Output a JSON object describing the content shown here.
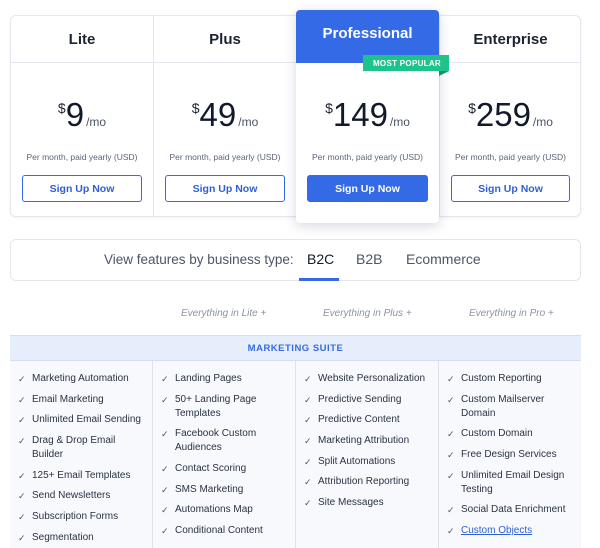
{
  "plans": [
    {
      "name": "Lite",
      "currency": "$",
      "amount": "9",
      "period": "/mo",
      "note": "Per month, paid yearly (USD)",
      "cta": "Sign Up Now"
    },
    {
      "name": "Plus",
      "currency": "$",
      "amount": "49",
      "period": "/mo",
      "note": "Per month, paid yearly (USD)",
      "cta": "Sign Up Now"
    },
    {
      "name": "Professional",
      "currency": "$",
      "amount": "149",
      "period": "/mo",
      "note": "Per month, paid yearly (USD)",
      "cta": "Sign Up Now",
      "badge": "MOST POPULAR"
    },
    {
      "name": "Enterprise",
      "currency": "$",
      "amount": "259",
      "period": "/mo",
      "note": "Per month, paid yearly (USD)",
      "cta": "Sign Up Now"
    }
  ],
  "selector": {
    "label": "View features by business type:",
    "options": [
      "B2C",
      "B2B",
      "Ecommerce"
    ],
    "selected": "B2C"
  },
  "everything": [
    "Everything in Lite +",
    "Everything in Plus +",
    "Everything in Pro +"
  ],
  "suite_title": "MARKETING SUITE",
  "features": [
    [
      "Marketing Automation",
      "Email Marketing",
      "Unlimited Email Sending",
      "Drag & Drop Email Builder",
      "125+ Email Templates",
      "Send Newsletters",
      "Subscription Forms",
      "Segmentation"
    ],
    [
      "Landing Pages",
      "50+ Landing Page Templates",
      "Facebook Custom Audiences",
      "Contact Scoring",
      "SMS Marketing",
      "Automations Map",
      "Conditional Content"
    ],
    [
      "Website Personalization",
      "Predictive Sending",
      "Predictive Content",
      "Marketing Attribution",
      "Split Automations",
      "Attribution Reporting",
      "Site Messages"
    ],
    [
      "Custom Reporting",
      "Custom Mailserver Domain",
      "Custom Domain",
      "Free Design Services",
      "Unlimited Email Design Testing",
      "Social Data Enrichment",
      "Custom Objects"
    ]
  ],
  "linked_features": [
    "Custom Objects"
  ],
  "check_icon": "check-icon",
  "colors": {
    "accent": "#356ae6",
    "badge": "#1ec28b",
    "suite_bg": "#e6eefc"
  }
}
